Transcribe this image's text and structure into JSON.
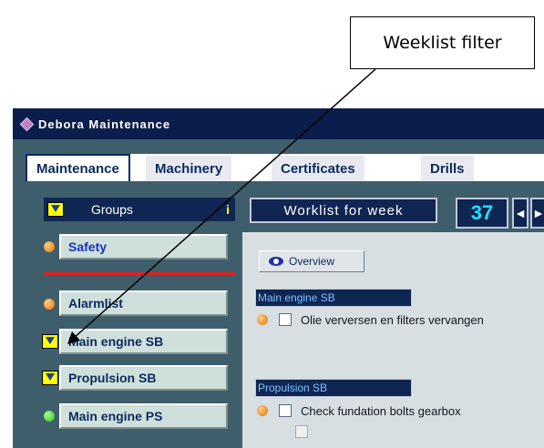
{
  "callout": {
    "label": "Weeklist filter"
  },
  "window": {
    "title": "Debora Maintenance"
  },
  "tabs": [
    {
      "label": "Maintenance",
      "active": true
    },
    {
      "label": "Machinery"
    },
    {
      "label": "Certificates"
    },
    {
      "label": "Drills"
    }
  ],
  "sidebar": {
    "header": "Groups",
    "header_info": "i",
    "groups": [
      {
        "label": "Safety",
        "indicator": "orange-dot"
      },
      {
        "label": "Alarmlist",
        "indicator": "orange-dot"
      },
      {
        "label": "Main engine SB",
        "indicator": "filter-funnel"
      },
      {
        "label": "Propulsion SB",
        "indicator": "filter-funnel"
      },
      {
        "label": "Main engine PS",
        "indicator": "green-dot"
      }
    ]
  },
  "main": {
    "worklist_label": "Worklist for week",
    "week_number": "37",
    "prev_icon": "◄",
    "next_icon": "►",
    "overview_label": "Overview",
    "sections": [
      {
        "title": "Main engine SB",
        "tasks": [
          {
            "label": "Olie verversen en filters vervangen"
          }
        ]
      },
      {
        "title": "Propulsion SB",
        "tasks": [
          {
            "label": "Check fundation bolts gearbox"
          }
        ]
      }
    ]
  },
  "colors": {
    "window_bg": "#3f5e6c",
    "title_bg": "#0b1d4a",
    "button_bg": "#cfe0dc",
    "week_number": "#20e0ff",
    "separator": "#e02020"
  }
}
